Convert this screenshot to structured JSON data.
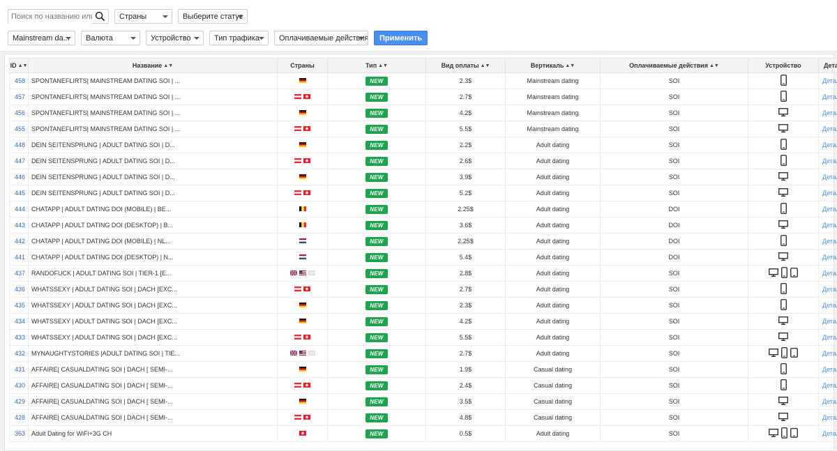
{
  "filters": {
    "search_placeholder": "Поиск по названию или ключ",
    "countries": "Страны",
    "status": "Выберите статус",
    "vertical": "Mainstream da...",
    "currency": "Валюта",
    "device": "Устройство",
    "traffic": "Тип трафика",
    "actions": "Оплачиваемые действия",
    "apply": "Применить"
  },
  "table": {
    "headers": {
      "id": "ID",
      "name": "Название",
      "countries": "Страны",
      "type": "Тип",
      "payment": "Вид оплаты",
      "vertical": "Вертикаль",
      "actions": "Оплачиваемые действия",
      "device": "Устройство",
      "details": "Детали"
    },
    "new_label": "NEW",
    "details_label": "Детали",
    "rows": [
      {
        "id": "458",
        "name": "SPONTANEFLIRTS| MAINSTREAM DATING SOI | ...",
        "flags": [
          "de"
        ],
        "payout": "2.3$",
        "vertical": "Mainstream dating",
        "action": "SOI",
        "devices": [
          "mobile"
        ]
      },
      {
        "id": "457",
        "name": "SPONTANEFLIRTS| MAINSTREAM DATING SOI | ...",
        "flags": [
          "at",
          "ch"
        ],
        "payout": "2.7$",
        "vertical": "Mainstream dating",
        "action": "SOI",
        "devices": [
          "mobile"
        ]
      },
      {
        "id": "456",
        "name": "SPONTANEFLIRTS| MAINSTREAM DATING SOI | ...",
        "flags": [
          "de"
        ],
        "payout": "4.2$",
        "vertical": "Mainstream dating",
        "action": "SOI",
        "devices": [
          "desktop"
        ]
      },
      {
        "id": "455",
        "name": "SPONTANEFLIRTS| MAINSTREAM DATING SOI | ...",
        "flags": [
          "at",
          "ch"
        ],
        "payout": "5.5$",
        "vertical": "Mainstream dating",
        "action": "SOI",
        "devices": [
          "desktop"
        ]
      },
      {
        "id": "448",
        "name": "DEIN SEITENSPRUNG | ADULT DATING SOI | D...",
        "flags": [
          "de"
        ],
        "payout": "2.2$",
        "vertical": "Adult dating",
        "action": "SOI",
        "devices": [
          "mobile"
        ]
      },
      {
        "id": "447",
        "name": "DEIN SEITENSPRUNG | ADULT DATING SOI | D...",
        "flags": [
          "at",
          "ch"
        ],
        "payout": "2.6$",
        "vertical": "Adult dating",
        "action": "SOI",
        "devices": [
          "mobile"
        ]
      },
      {
        "id": "446",
        "name": "DEIN SEITENSPRUNG | ADULT DATING SOI | D...",
        "flags": [
          "de"
        ],
        "payout": "3.9$",
        "vertical": "Adult dating",
        "action": "SOI",
        "devices": [
          "desktop"
        ]
      },
      {
        "id": "445",
        "name": "DEIN SEITENSPRUNG | ADULT DATING SOI | D...",
        "flags": [
          "at",
          "ch"
        ],
        "payout": "5.2$",
        "vertical": "Adult dating",
        "action": "SOI",
        "devices": [
          "desktop"
        ]
      },
      {
        "id": "444",
        "name": "CHATAPP | ADULT DATING DOI (MOBILE) | BE...",
        "flags": [
          "be"
        ],
        "payout": "2.25$",
        "vertical": "Adult dating",
        "action": "DOI",
        "devices": [
          "mobile"
        ]
      },
      {
        "id": "443",
        "name": "CHATAPP | ADULT DATING DOI (DESKTOP) | B...",
        "flags": [
          "be"
        ],
        "payout": "3.6$",
        "vertical": "Adult dating",
        "action": "DOI",
        "devices": [
          "desktop"
        ]
      },
      {
        "id": "442",
        "name": "CHATAPP | ADULT DATING DOI (MOBILE) | NL...",
        "flags": [
          "nl"
        ],
        "payout": "2.25$",
        "vertical": "Adult dating",
        "action": "DOI",
        "devices": [
          "mobile"
        ]
      },
      {
        "id": "441",
        "name": "CHATAPP | ADULT DATING DOI (DESKTOP) | N...",
        "flags": [
          "nl"
        ],
        "payout": "5.4$",
        "vertical": "Adult dating",
        "action": "DOI",
        "devices": [
          "desktop"
        ]
      },
      {
        "id": "437",
        "name": "RANDOFUCK | ADULT DATING SOI | TIER-1 [E...",
        "flags": [
          "gb",
          "us",
          "other"
        ],
        "payout": "2.8$",
        "vertical": "Adult dating",
        "action": "SOI",
        "devices": [
          "desktop",
          "mobile",
          "tablet"
        ]
      },
      {
        "id": "436",
        "name": "WHATSSEXY | ADULT DATING SOI | DACH [EXC...",
        "flags": [
          "at",
          "ch"
        ],
        "payout": "2.7$",
        "vertical": "Adult dating",
        "action": "SOI",
        "devices": [
          "mobile"
        ]
      },
      {
        "id": "435",
        "name": "WHATSSEXY | ADULT DATING SOI | DACH [EXC...",
        "flags": [
          "de"
        ],
        "payout": "2.3$",
        "vertical": "Adult dating",
        "action": "SOI",
        "devices": [
          "mobile"
        ]
      },
      {
        "id": "434",
        "name": "WHATSSEXY | ADULT DATING SOI | DACH [EXC...",
        "flags": [
          "de"
        ],
        "payout": "4.2$",
        "vertical": "Adult dating",
        "action": "SOI",
        "devices": [
          "desktop"
        ]
      },
      {
        "id": "433",
        "name": "WHATSSEXY | ADULT DATING SOI | DACH [EXC...",
        "flags": [
          "at",
          "ch"
        ],
        "payout": "5.5$",
        "vertical": "Adult dating",
        "action": "SOI",
        "devices": [
          "desktop"
        ]
      },
      {
        "id": "432",
        "name": "MYNAUGHTYSTORIES |ADULT DATING SOI | TIE...",
        "flags": [
          "gb",
          "us",
          "other"
        ],
        "payout": "2.7$",
        "vertical": "Adult dating",
        "action": "SOI",
        "devices": [
          "desktop",
          "mobile",
          "tablet"
        ]
      },
      {
        "id": "431",
        "name": "AFFAIRE| CASUALDATING SOI | DACH [ SEMI-...",
        "flags": [
          "de"
        ],
        "payout": "1.9$",
        "vertical": "Casual dating",
        "action": "SOI",
        "devices": [
          "mobile"
        ]
      },
      {
        "id": "430",
        "name": "AFFAIRE| CASUALDATING SOI | DACH [ SEMI-...",
        "flags": [
          "at",
          "ch"
        ],
        "payout": "2.4$",
        "vertical": "Casual dating",
        "action": "SOI",
        "devices": [
          "mobile"
        ]
      },
      {
        "id": "429",
        "name": "AFFAIRE| CASUALDATING SOI | DACH [ SEMI-...",
        "flags": [
          "de"
        ],
        "payout": "3.5$",
        "vertical": "Casual dating",
        "action": "SOI",
        "devices": [
          "desktop"
        ]
      },
      {
        "id": "428",
        "name": "AFFAIRE| CASUALDATING SOI | DACH [ SEMI-...",
        "flags": [
          "at",
          "ch"
        ],
        "payout": "4.8$",
        "vertical": "Casual dating",
        "action": "SOI",
        "devices": [
          "desktop"
        ]
      },
      {
        "id": "363",
        "name": "Adult Dating for WiFi+3G CH",
        "flags": [
          "ch"
        ],
        "payout": "0.5$",
        "vertical": "Adult dating",
        "action": "SOI",
        "devices": [
          "desktop",
          "mobile",
          "tablet"
        ]
      }
    ]
  }
}
